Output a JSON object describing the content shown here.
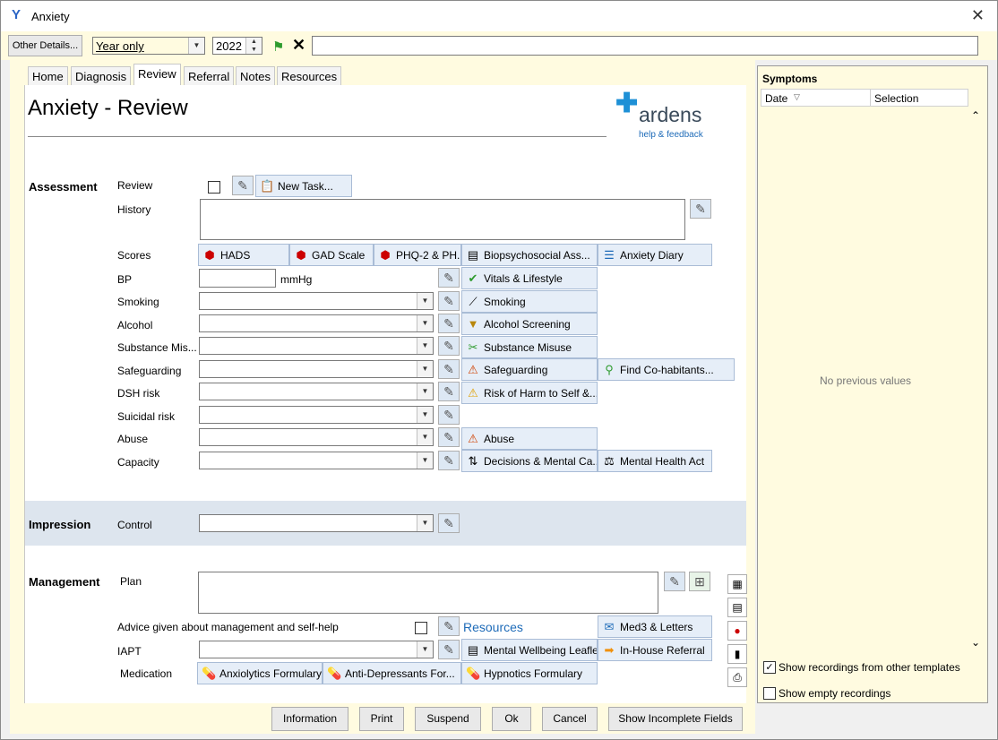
{
  "window": {
    "title": "Anxiety",
    "close": "✕"
  },
  "toolbar": {
    "other_details": "Other Details...",
    "period": "Year only",
    "year": "2022",
    "free_text": ""
  },
  "tabs": [
    {
      "label": "Home"
    },
    {
      "label": "Diagnosis"
    },
    {
      "label": "Review"
    },
    {
      "label": "Referral"
    },
    {
      "label": "Notes"
    },
    {
      "label": "Resources"
    }
  ],
  "page": {
    "title": "Anxiety - Review"
  },
  "logo": {
    "name": "ardens",
    "feedback": "help & feedback"
  },
  "assessment": {
    "section": "Assessment",
    "review": "Review",
    "new_task": "New Task...",
    "history": "History",
    "scores": "Scores",
    "score_buttons": [
      "HADS",
      "GAD Scale",
      "PHQ-2 & PH...",
      "Biopsychosocial Ass...",
      "Anxiety Diary"
    ],
    "bp": "BP",
    "bp_unit": "mmHg",
    "rows": [
      {
        "label": "Smoking",
        "btn": "Smoking"
      },
      {
        "label": "Alcohol",
        "btn": "Alcohol Screening"
      },
      {
        "label": "Substance Mis...",
        "btn": "Substance Misuse"
      },
      {
        "label": "Safeguarding",
        "btn": "Safeguarding",
        "btn2": "Find Co-habitants..."
      },
      {
        "label": "DSH risk",
        "btn": "Risk of Harm to Self &..."
      },
      {
        "label": "Suicidal risk"
      },
      {
        "label": "Abuse",
        "btn": "Abuse"
      },
      {
        "label": "Capacity",
        "btn": "Decisions & Mental Ca...",
        "btn2": "Mental Health Act"
      }
    ],
    "vitals": "Vitals & Lifestyle"
  },
  "impression": {
    "section": "Impression",
    "control": "Control"
  },
  "management": {
    "section": "Management",
    "plan": "Plan",
    "advice": "Advice given about management and self-help",
    "resources": "Resources",
    "med3": "Med3 & Letters",
    "iapt": "IAPT",
    "leaflet": "Mental Wellbeing Leaflet",
    "inhouse": "In-House Referral",
    "medication": "Medication",
    "formularies": [
      "Anxiolytics Formulary",
      "Anti-Depressants For...",
      "Hypnotics Formulary"
    ]
  },
  "symptoms": {
    "title": "Symptoms",
    "col_date": "Date",
    "col_selection": "Selection",
    "empty": "No previous values",
    "show_other": "Show recordings from other templates",
    "show_empty": "Show empty recordings"
  },
  "footer": {
    "information": "Information",
    "print": "Print",
    "suspend": "Suspend",
    "ok": "Ok",
    "cancel": "Cancel",
    "incomplete": "Show Incomplete Fields"
  }
}
